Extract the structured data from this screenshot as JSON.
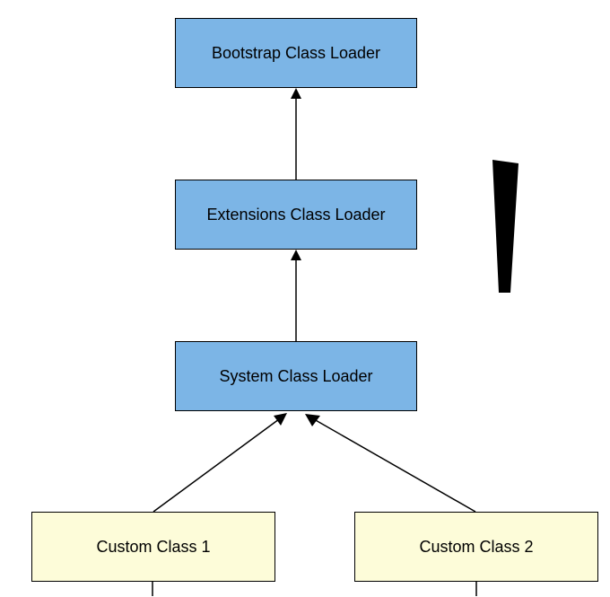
{
  "nodes": {
    "bootstrap": {
      "label": "Bootstrap Class Loader"
    },
    "extensions": {
      "label": "Extensions Class Loader"
    },
    "system": {
      "label": "System Class Loader"
    },
    "custom1": {
      "label": "Custom Class 1"
    },
    "custom2": {
      "label": "Custom Class 2"
    }
  },
  "colors": {
    "blue": "#7cb5e6",
    "yellow": "#fdfcd9",
    "stroke": "#000000"
  }
}
